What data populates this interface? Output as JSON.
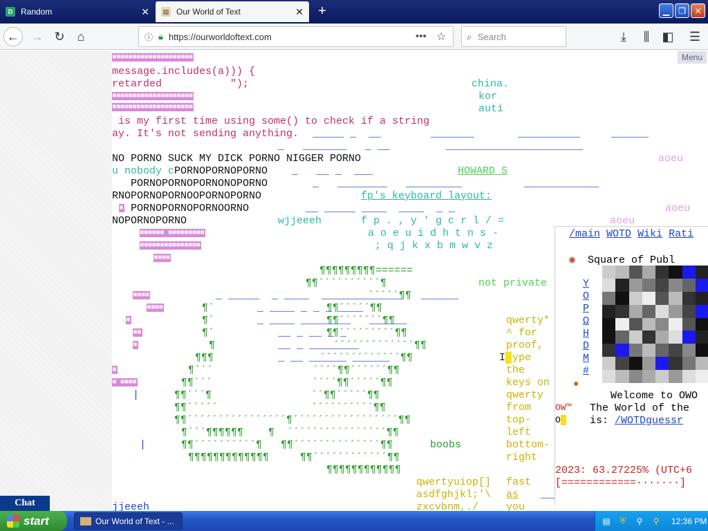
{
  "browser": {
    "tabs": [
      {
        "label": "Random",
        "favicon": "D"
      },
      {
        "label": "Our World of Text",
        "favicon": "scroll-icon"
      }
    ],
    "url": "https://ourworldoftext.com",
    "search_placeholder": "Search",
    "new_tab": "+",
    "icons": [
      "back-icon",
      "forward-icon",
      "reload-icon",
      "home-icon",
      "info-icon",
      "lock-icon",
      "page-actions-icon",
      "bookmark-star-icon",
      "download-icon",
      "library-icon",
      "sidebar-icon",
      "hamburger-menu-icon"
    ]
  },
  "page": {
    "menu_label": "Menu",
    "chat_label": "Chat",
    "lines": [
      {
        "text": "message.includes(a))) {",
        "cls": "m"
      },
      {
        "text": "retarded           \");",
        "cls": "m"
      },
      {
        "text": " is my first time using some() to check if a string",
        "cls": "m"
      },
      {
        "text": "ay. It's not sending anything.",
        "cls": "m"
      },
      {
        "text": "NO PORNO SUCK MY DICK PORNO NIGGER PORNO",
        "cls": "mk"
      },
      {
        "text": "u nobody c",
        "cls": "c"
      },
      {
        "text": "PORNOPORNOPORNO",
        "cls": "mk"
      },
      {
        "text": "   PORNOPORNOPORNONOPORNO",
        "cls": "mk"
      },
      {
        "text": "RNOPORNOPORNOOPORNOPORNO",
        "cls": "mk"
      },
      {
        "text": "   PORNOPORNOPORNOORNO",
        "cls": "mk"
      },
      {
        "text": "NOPORNOPORNO",
        "cls": "mk"
      }
    ],
    "right_words": {
      "china": "china.",
      "kor": "kor",
      "auti": "auti",
      "howard": "HOWARD S",
      "fp_layout": "fp's keyboard layout:",
      "row1": "f p . , y ' g c r l / =",
      "row2": "a o e u i d h t n s -",
      "row3": "; q j k x b m w v z",
      "wjjeeeh": "wjjeeeh",
      "not_private": "not private",
      "aoeu1": "aoeu",
      "aoeu2": "aoeu",
      "aoeu3": "aoeu",
      "qwerty_col": [
        "qwerty*",
        "^ for",
        "proof,",
        "type",
        "the",
        "keys on",
        "qwerty",
        "from",
        "top-",
        "left",
        "bottom-",
        "right"
      ],
      "kb1": "qwertyuiop[]",
      "kb2": "asdfghjkl;'\\",
      "kb3": "zxcvbnm,./",
      "fast": "fast",
      "as": "as",
      "you": "you",
      "boobs": "boobs",
      "jjeeeh": "jjeeeh"
    },
    "panel": {
      "links": [
        "/main",
        "WOTD",
        "Wiki",
        "Rati"
      ],
      "square_title": "Square of Publ",
      "list_letters": [
        "Y",
        "O",
        "P",
        "Ω",
        "H",
        "D",
        "M",
        "#"
      ],
      "welcome": "Welcome to OWO",
      "owtm": "OW™",
      "world_line": "The World of the",
      "is_line": "is:",
      "guess_link": "/WOTDguessr",
      "o_letter": "O",
      "year_line": "2023: 63.27225% (UTC+6",
      "progress_text": "[============·······]",
      "year_progress": 0.6327225
    }
  },
  "taskbar": {
    "start_label": "start",
    "task_label": "Our World of Text - ...",
    "clock": "12:36 PM",
    "colors": {
      "taskbar": "#2355c7",
      "start": "#3a9b3a",
      "tray": "#0d88d8"
    }
  }
}
